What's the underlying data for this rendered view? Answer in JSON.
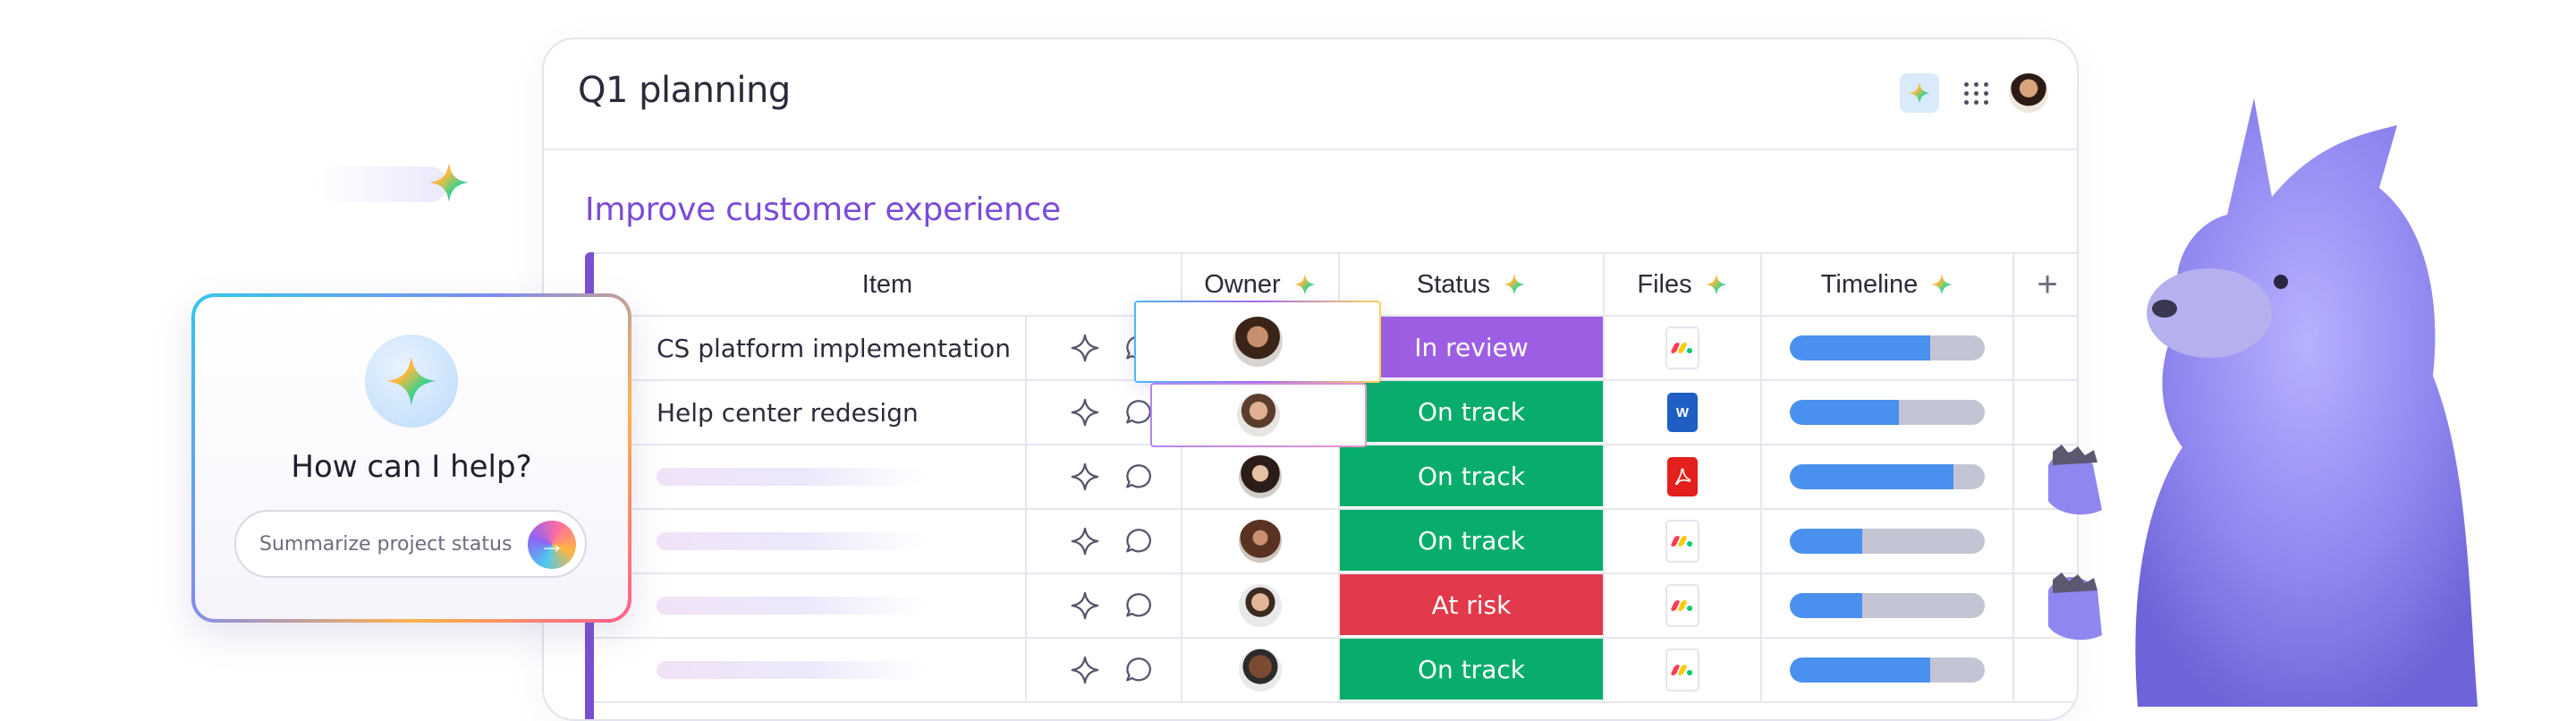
{
  "board": {
    "title": "Q1 planning",
    "group_title": "Improve customer experience",
    "columns": {
      "item": "Item",
      "owner": "Owner",
      "status": "Status",
      "files": "Files",
      "timeline": "Timeline",
      "add": "+"
    },
    "rows": [
      {
        "item": "CS platform implementation",
        "status": "In review",
        "status_color": "#9d5ee3",
        "file": "monday-file-icon",
        "timeline": 0.72,
        "owner": "avatar-woman-long-hair"
      },
      {
        "item": "Help center redesign",
        "status": "On track",
        "status_color": "#08ad6c",
        "file": "word-file-icon",
        "timeline": 0.56,
        "owner": "avatar-man-beard"
      },
      {
        "item": "",
        "status": "On track",
        "status_color": "#08ad6c",
        "file": "pdf-file-icon",
        "timeline": 0.84,
        "owner": "avatar-woman-dark-hair"
      },
      {
        "item": "",
        "status": "On track",
        "status_color": "#08ad6c",
        "file": "monday-file-icon",
        "timeline": 0.37,
        "owner": "avatar-woman-curly"
      },
      {
        "item": "",
        "status": "At risk",
        "status_color": "#e2394b",
        "file": "monday-file-icon",
        "timeline": 0.37,
        "owner": "avatar-man-stubble"
      },
      {
        "item": "",
        "status": "On track",
        "status_color": "#08ad6c",
        "file": "monday-file-icon",
        "timeline": 0.72,
        "owner": "avatar-man-bald"
      }
    ]
  },
  "assistant": {
    "title": "How can I help?",
    "input_value": "Summarize project status"
  },
  "colors": {
    "accent": "#7b4bd8",
    "timeline_fill": "#4a90ee",
    "timeline_track": "#c4c5d4"
  }
}
